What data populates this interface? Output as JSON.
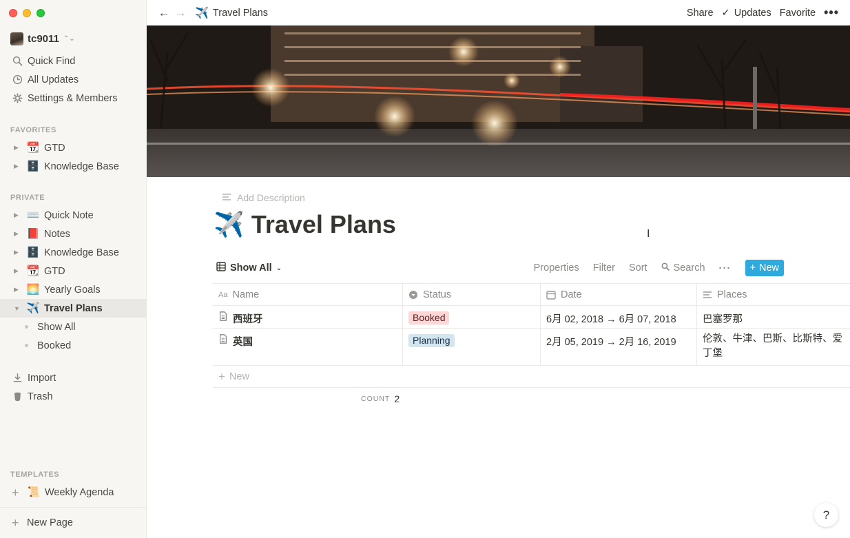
{
  "workspace": {
    "name": "tc9011"
  },
  "sidebar": {
    "top_items": [
      {
        "label": "Quick Find",
        "icon": "search-icon"
      },
      {
        "label": "All Updates",
        "icon": "clock-icon"
      },
      {
        "label": "Settings & Members",
        "icon": "gear-icon"
      }
    ],
    "favorites_label": "FAVORITES",
    "favorites": [
      {
        "label": "GTD",
        "emoji": "📆"
      },
      {
        "label": "Knowledge Base",
        "emoji": "🗄️"
      }
    ],
    "private_label": "PRIVATE",
    "private": [
      {
        "label": "Quick Note",
        "emoji": "⌨️"
      },
      {
        "label": "Notes",
        "emoji": "📕"
      },
      {
        "label": "Knowledge Base",
        "emoji": "🗄️"
      },
      {
        "label": "GTD",
        "emoji": "📆"
      },
      {
        "label": "Yearly Goals",
        "emoji": "🌅"
      },
      {
        "label": "Travel Plans",
        "emoji": "✈️"
      }
    ],
    "sub_items": [
      "Show All",
      "Booked"
    ],
    "import_label": "Import",
    "trash_label": "Trash",
    "templates_label": "TEMPLATES",
    "template": {
      "label": "Weekly Agenda",
      "emoji": "📜"
    },
    "new_page_label": "New Page"
  },
  "topbar": {
    "breadcrumb_emoji": "✈️",
    "breadcrumb": "Travel Plans",
    "share": "Share",
    "updates": "Updates",
    "favorite": "Favorite",
    "more": "•••"
  },
  "page": {
    "add_description": "Add Description",
    "title_emoji": "✈️",
    "title": "Travel Plans"
  },
  "toolbar": {
    "view": "Show All",
    "properties": "Properties",
    "filter": "Filter",
    "sort": "Sort",
    "search": "Search",
    "more": "···",
    "new": "New"
  },
  "table": {
    "headers": [
      "Name",
      "Status",
      "Date",
      "Places"
    ],
    "rows": [
      {
        "name": "西班牙",
        "status": "Booked",
        "date": "6月 02, 2018 → 6月 07, 2018",
        "places": "巴塞罗那"
      },
      {
        "name": "英国",
        "status": "Planning",
        "date": "2月 05, 2019 → 2月 16, 2019",
        "places": "伦敦、牛津、巴斯、比斯特、爱丁堡"
      }
    ],
    "new_row": "New",
    "count_label": "COUNT",
    "count_value": "2"
  },
  "help": "?",
  "colors": {
    "accent": "#2eaadc",
    "booked_tag": "#ffd6d6",
    "planning_tag": "#d3e5ef",
    "sidebar_bg": "#f7f6f3"
  }
}
